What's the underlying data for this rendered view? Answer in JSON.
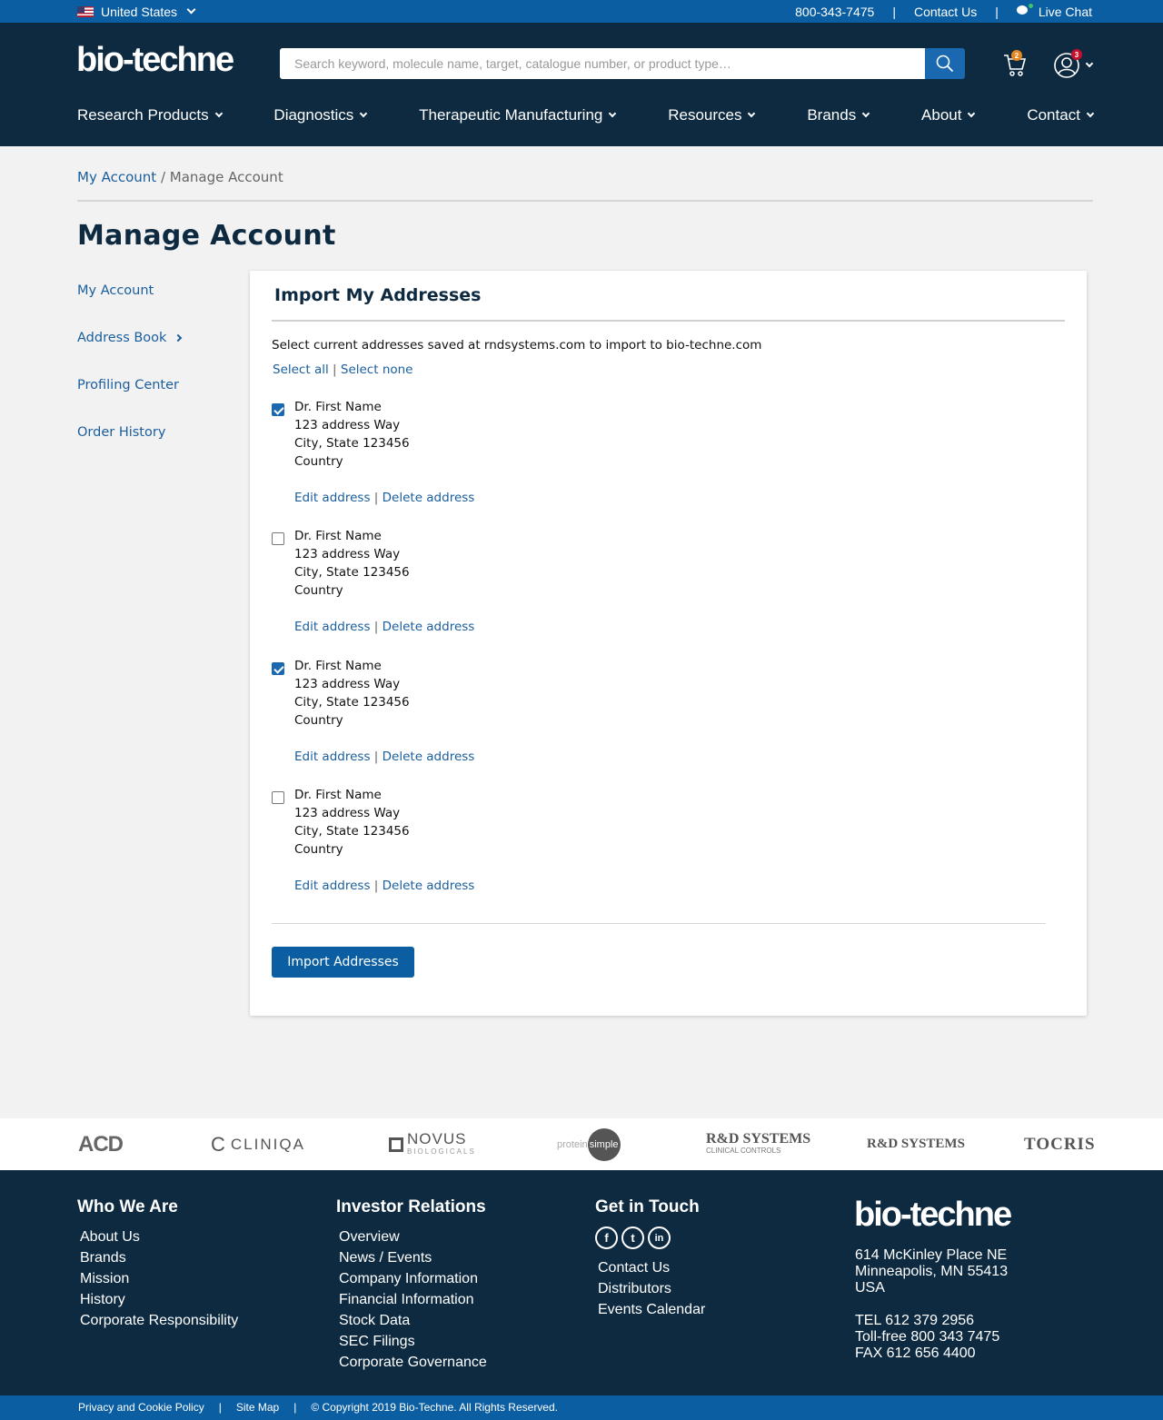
{
  "topbar": {
    "region": "United States",
    "phone": "800-343-7475",
    "sep": "|",
    "contact": "Contact Us",
    "chat": "Live Chat"
  },
  "header": {
    "logo": "bio-techne",
    "search_placeholder": "Search keyword, molecule name, target, catalogue number, or product type…",
    "cart_count": "2",
    "account_count": "3",
    "nav": [
      "Research Products",
      "Diagnostics",
      "Therapeutic Manufacturing",
      "Resources",
      "Brands",
      "About",
      "Contact"
    ]
  },
  "breadcrumb": {
    "root": "My Account",
    "sep": "/",
    "current": "Manage Account"
  },
  "page_title": "Manage Account",
  "sidenav": [
    "My Account",
    "Address Book",
    "Profiling Center",
    "Order History"
  ],
  "card": {
    "title": "Import My Addresses",
    "intro": "Select current addresses saved at rndsystems.com to import to bio-techne.com",
    "select_all": "Select all",
    "select_none": "Select none",
    "sep": "|",
    "edit_label": "Edit address",
    "delete_label": "Delete address",
    "addresses": [
      {
        "checked": true,
        "name": "Dr. First Name",
        "street": "123 address Way",
        "city": "City, State 123456",
        "country": "Country"
      },
      {
        "checked": false,
        "name": "Dr. First Name",
        "street": "123 address Way",
        "city": "City, State 123456",
        "country": "Country"
      },
      {
        "checked": true,
        "name": "Dr. First Name",
        "street": "123 address Way",
        "city": "City, State 123456",
        "country": "Country"
      },
      {
        "checked": false,
        "name": "Dr. First Name",
        "street": "123 address Way",
        "city": "City, State 123456",
        "country": "Country"
      }
    ],
    "button": "Import Addresses"
  },
  "brands": {
    "acd": "ACD",
    "cliniqa": "CLINIQA",
    "novus": "NOVUS",
    "novus_sub": "BIOLOGICALS",
    "ps_a": "protein",
    "ps_b": "simple",
    "rd_clin": "R&D SYSTEMS",
    "rd_clin_sub": "CLINICAL CONTROLS",
    "rd": "R&D SYSTEMS",
    "tocris": "TOCRIS"
  },
  "footer": {
    "who": {
      "title": "Who We Are",
      "links": [
        "About Us",
        "Brands",
        "Mission",
        "History",
        "Corporate Responsibility"
      ]
    },
    "investor": {
      "title": "Investor Relations",
      "links": [
        "Overview",
        "News / Events",
        "Company Information",
        "Financial Information",
        "Stock Data",
        "SEC Filings",
        "Corporate Governance"
      ]
    },
    "touch": {
      "title": "Get in Touch",
      "links": [
        "Contact Us",
        "Distributors",
        "Events Calendar"
      ],
      "social": [
        "f",
        "t",
        "in"
      ]
    },
    "logo": "bio-techne",
    "address": [
      "614 McKinley Place NE",
      "Minneapolis, MN 55413",
      "USA"
    ],
    "phones": [
      "TEL 612 379 2956",
      "Toll-free 800 343 7475",
      "FAX 612 656 4400"
    ]
  },
  "bottombar": {
    "privacy": "Privacy and Cookie Policy",
    "sep": "|",
    "sitemap": "Site Map",
    "copyright": "© Copyright 2019 Bio-Techne. All Rights Reserved."
  },
  "colors": {
    "primary": "#0b5ea1",
    "navy": "#0d2a40",
    "link": "#1a5e9c",
    "cart_badge": "#e8871e",
    "account_badge": "#c8102e"
  }
}
